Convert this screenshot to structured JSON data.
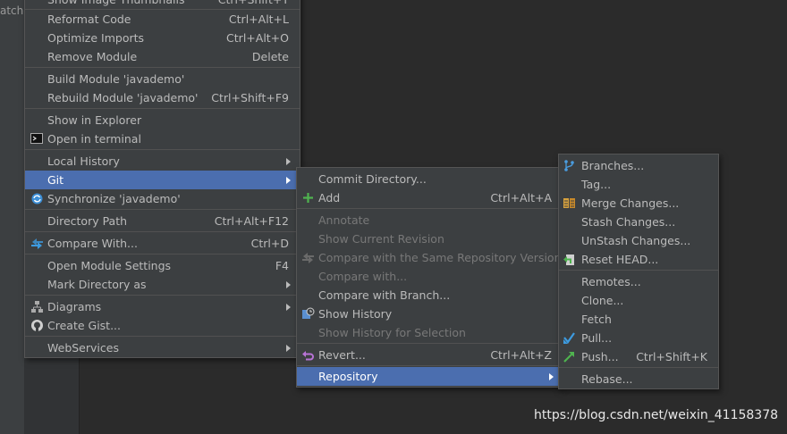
{
  "background": {
    "left_text": "atche"
  },
  "menu1": {
    "partial_top": "Show Image Thumbnails",
    "partial_top_sc": "Ctrl+Shift+T",
    "items": [
      {
        "label": "Reformat Code",
        "shortcut": "Ctrl+Alt+L"
      },
      {
        "label": "Optimize Imports",
        "shortcut": "Ctrl+Alt+O"
      },
      {
        "label": "Remove Module",
        "shortcut": "Delete"
      },
      {
        "label": "Build Module 'javademo'",
        "shortcut": ""
      },
      {
        "label": "Rebuild Module 'javademo'",
        "shortcut": "Ctrl+Shift+F9"
      },
      {
        "label": "Show in Explorer",
        "shortcut": ""
      },
      {
        "label": "Open in terminal",
        "shortcut": ""
      },
      {
        "label": "Local History",
        "shortcut": ""
      },
      {
        "label": "Git",
        "shortcut": ""
      },
      {
        "label": "Synchronize 'javademo'",
        "shortcut": ""
      },
      {
        "label": "Directory Path",
        "shortcut": "Ctrl+Alt+F12"
      },
      {
        "label": "Compare With...",
        "shortcut": "Ctrl+D"
      },
      {
        "label": "Open Module Settings",
        "shortcut": "F4"
      },
      {
        "label": "Mark Directory as",
        "shortcut": ""
      },
      {
        "label": "Diagrams",
        "shortcut": ""
      },
      {
        "label": "Create Gist...",
        "shortcut": ""
      },
      {
        "label": "WebServices",
        "shortcut": ""
      }
    ]
  },
  "menu2": {
    "items": [
      {
        "label": "Commit Directory...",
        "shortcut": ""
      },
      {
        "label": "Add",
        "shortcut": "Ctrl+Alt+A"
      },
      {
        "label": "Annotate",
        "shortcut": ""
      },
      {
        "label": "Show Current Revision",
        "shortcut": ""
      },
      {
        "label": "Compare with the Same Repository Version",
        "shortcut": ""
      },
      {
        "label": "Compare with...",
        "shortcut": ""
      },
      {
        "label": "Compare with Branch...",
        "shortcut": ""
      },
      {
        "label": "Show History",
        "shortcut": ""
      },
      {
        "label": "Show History for Selection",
        "shortcut": ""
      },
      {
        "label": "Revert...",
        "shortcut": "Ctrl+Alt+Z"
      },
      {
        "label": "Repository",
        "shortcut": ""
      }
    ]
  },
  "menu3": {
    "items": [
      {
        "label": "Branches...",
        "shortcut": ""
      },
      {
        "label": "Tag...",
        "shortcut": ""
      },
      {
        "label": "Merge Changes...",
        "shortcut": ""
      },
      {
        "label": "Stash Changes...",
        "shortcut": ""
      },
      {
        "label": "UnStash Changes...",
        "shortcut": ""
      },
      {
        "label": "Reset HEAD...",
        "shortcut": ""
      },
      {
        "label": "Remotes...",
        "shortcut": ""
      },
      {
        "label": "Clone...",
        "shortcut": ""
      },
      {
        "label": "Fetch",
        "shortcut": ""
      },
      {
        "label": "Pull...",
        "shortcut": ""
      },
      {
        "label": "Push...",
        "shortcut": "Ctrl+Shift+K"
      },
      {
        "label": "Rebase...",
        "shortcut": ""
      }
    ]
  },
  "colors": {
    "menu_bg": "#3c3f41",
    "selection": "#4b6eaf",
    "disabled": "#787878",
    "text": "#bbbbbb"
  },
  "watermark": "https://blog.csdn.net/weixin_41158378"
}
